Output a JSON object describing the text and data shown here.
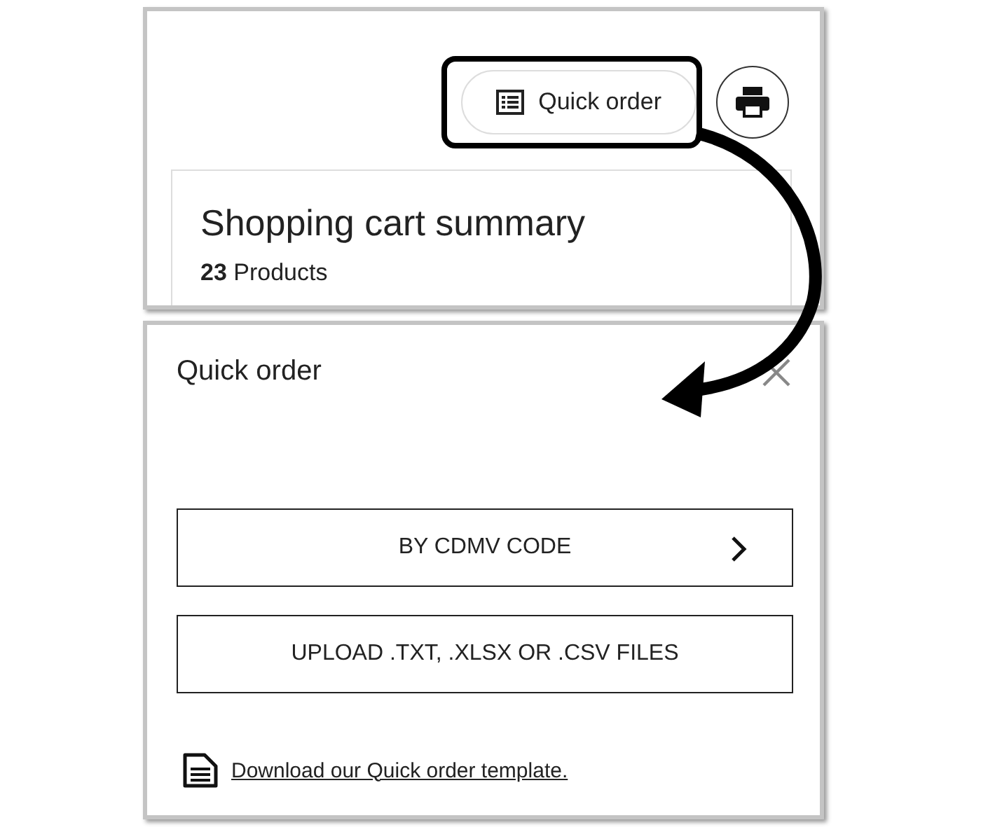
{
  "cart_header": {
    "quick_order_button": {
      "label": "Quick order",
      "highlighted": true
    },
    "summary": {
      "title": "Shopping cart summary",
      "count": "**23** Products"
    }
  },
  "quick_order_panel": {
    "title": "Quick order",
    "options": [
      {
        "label": "BY CDMV CODE",
        "kind": "next"
      },
      {
        "label": "UPLOAD .TXT, .XLSX OR .CSV FILES",
        "kind": "plain"
      }
    ],
    "template_link": "Download our Quick order template."
  }
}
